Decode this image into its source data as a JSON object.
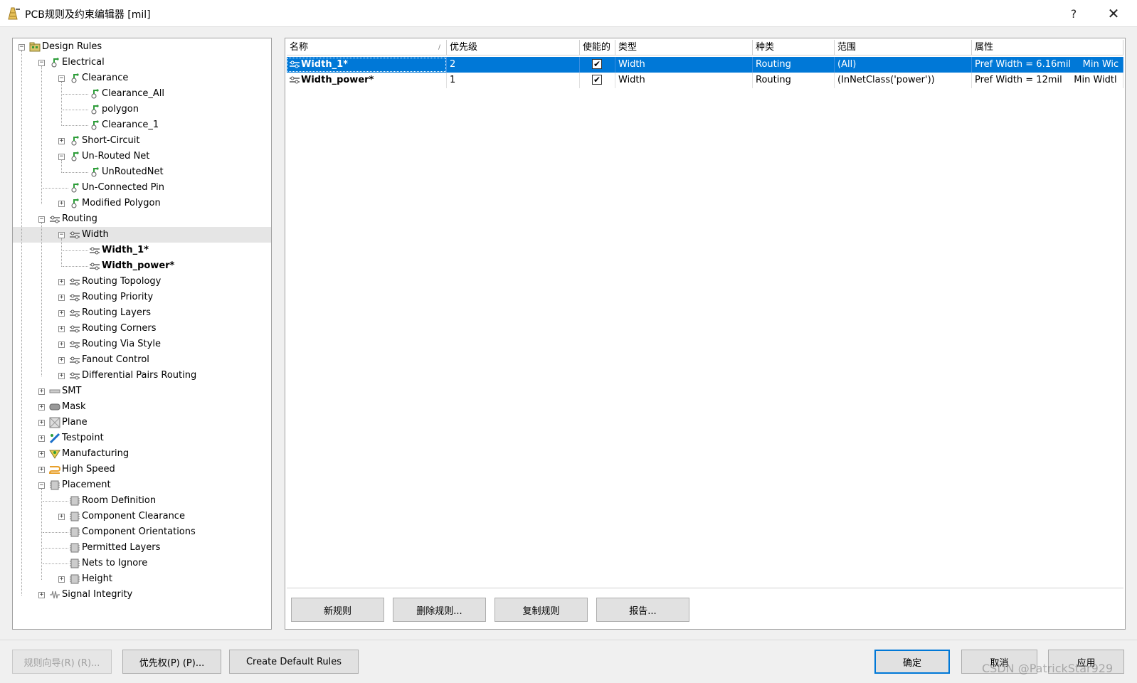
{
  "window": {
    "title": "PCB规则及约束编辑器 [mil]",
    "help_label": "?",
    "close_label": "✕"
  },
  "tree": [
    {
      "id": "design-rules",
      "label": "Design Rules",
      "level": 0,
      "expander": "minus",
      "icon": "folder-icon"
    },
    {
      "id": "electrical",
      "label": "Electrical",
      "level": 1,
      "expander": "minus",
      "icon": "electrical-rule-icon"
    },
    {
      "id": "clearance",
      "label": "Clearance",
      "level": 2,
      "expander": "minus",
      "icon": "electrical-rule-icon"
    },
    {
      "id": "clearance-all",
      "label": "Clearance_All",
      "level": 3,
      "expander": "none",
      "icon": "electrical-rule-icon"
    },
    {
      "id": "polygon",
      "label": "polygon",
      "level": 3,
      "expander": "none",
      "icon": "electrical-rule-icon"
    },
    {
      "id": "clearance-1",
      "label": "Clearance_1",
      "level": 3,
      "expander": "none",
      "icon": "electrical-rule-icon"
    },
    {
      "id": "short-circuit",
      "label": "Short-Circuit",
      "level": 2,
      "expander": "plus",
      "icon": "electrical-rule-icon"
    },
    {
      "id": "un-routed-net",
      "label": "Un-Routed Net",
      "level": 2,
      "expander": "minus",
      "icon": "electrical-rule-icon"
    },
    {
      "id": "unroutednet",
      "label": "UnRoutedNet",
      "level": 3,
      "expander": "none",
      "icon": "electrical-rule-icon"
    },
    {
      "id": "un-connected-pin",
      "label": "Un-Connected Pin",
      "level": 2,
      "expander": "none",
      "icon": "electrical-rule-icon"
    },
    {
      "id": "modified-polygon",
      "label": "Modified Polygon",
      "level": 2,
      "expander": "plus",
      "icon": "electrical-rule-icon"
    },
    {
      "id": "routing",
      "label": "Routing",
      "level": 1,
      "expander": "minus",
      "icon": "routing-rule-icon"
    },
    {
      "id": "width",
      "label": "Width",
      "level": 2,
      "expander": "minus",
      "icon": "routing-rule-icon",
      "highlight": true
    },
    {
      "id": "width-1",
      "label": "Width_1*",
      "level": 3,
      "expander": "none",
      "icon": "routing-rule-icon",
      "bold": true
    },
    {
      "id": "width-power",
      "label": "Width_power*",
      "level": 3,
      "expander": "none",
      "icon": "routing-rule-icon",
      "bold": true
    },
    {
      "id": "routing-topology",
      "label": "Routing Topology",
      "level": 2,
      "expander": "plus",
      "icon": "routing-rule-icon"
    },
    {
      "id": "routing-priority",
      "label": "Routing Priority",
      "level": 2,
      "expander": "plus",
      "icon": "routing-rule-icon"
    },
    {
      "id": "routing-layers",
      "label": "Routing Layers",
      "level": 2,
      "expander": "plus",
      "icon": "routing-rule-icon"
    },
    {
      "id": "routing-corners",
      "label": "Routing Corners",
      "level": 2,
      "expander": "plus",
      "icon": "routing-rule-icon"
    },
    {
      "id": "routing-via-style",
      "label": "Routing Via Style",
      "level": 2,
      "expander": "plus",
      "icon": "routing-rule-icon"
    },
    {
      "id": "fanout-control",
      "label": "Fanout Control",
      "level": 2,
      "expander": "plus",
      "icon": "routing-rule-icon"
    },
    {
      "id": "differential-pairs-routing",
      "label": "Differential Pairs Routing",
      "level": 2,
      "expander": "plus",
      "icon": "routing-rule-icon"
    },
    {
      "id": "smt",
      "label": "SMT",
      "level": 1,
      "expander": "plus",
      "icon": "smt-rule-icon"
    },
    {
      "id": "mask",
      "label": "Mask",
      "level": 1,
      "expander": "plus",
      "icon": "mask-rule-icon"
    },
    {
      "id": "plane",
      "label": "Plane",
      "level": 1,
      "expander": "plus",
      "icon": "plane-rule-icon"
    },
    {
      "id": "testpoint",
      "label": "Testpoint",
      "level": 1,
      "expander": "plus",
      "icon": "testpoint-rule-icon"
    },
    {
      "id": "manufacturing",
      "label": "Manufacturing",
      "level": 1,
      "expander": "plus",
      "icon": "manufacturing-rule-icon"
    },
    {
      "id": "high-speed",
      "label": "High Speed",
      "level": 1,
      "expander": "plus",
      "icon": "high-speed-rule-icon"
    },
    {
      "id": "placement",
      "label": "Placement",
      "level": 1,
      "expander": "minus",
      "icon": "placement-rule-icon"
    },
    {
      "id": "room-definition",
      "label": "Room Definition",
      "level": 2,
      "expander": "none",
      "icon": "placement-rule-icon"
    },
    {
      "id": "component-clearance",
      "label": "Component Clearance",
      "level": 2,
      "expander": "plus",
      "icon": "placement-rule-icon"
    },
    {
      "id": "component-orientations",
      "label": "Component Orientations",
      "level": 2,
      "expander": "none",
      "icon": "placement-rule-icon"
    },
    {
      "id": "permitted-layers",
      "label": "Permitted Layers",
      "level": 2,
      "expander": "none",
      "icon": "placement-rule-icon"
    },
    {
      "id": "nets-to-ignore",
      "label": "Nets to Ignore",
      "level": 2,
      "expander": "none",
      "icon": "placement-rule-icon"
    },
    {
      "id": "height",
      "label": "Height",
      "level": 2,
      "expander": "plus",
      "icon": "placement-rule-icon"
    },
    {
      "id": "signal-integrity",
      "label": "Signal Integrity",
      "level": 1,
      "expander": "plus",
      "icon": "signal-integrity-rule-icon"
    }
  ],
  "table": {
    "columns": [
      "名称",
      "优先级",
      "使能的",
      "类型",
      "种类",
      "范围",
      "属性"
    ],
    "rows": [
      {
        "name": "Width_1*",
        "priority": "2",
        "enabled": true,
        "type": "Width",
        "category": "Routing",
        "scope": "(All)",
        "attrs": "Pref Width = 6.16mil    Min Wic",
        "selected": true
      },
      {
        "name": "Width_power*",
        "priority": "1",
        "enabled": true,
        "type": "Width",
        "category": "Routing",
        "scope": "(InNetClass('power'))",
        "attrs": "Pref Width = 12mil    Min Widtl",
        "selected": false
      }
    ]
  },
  "rule_buttons": {
    "new_rule": "新规则",
    "delete_rule": "删除规则...",
    "copy_rule": "复制规则",
    "report": "报告..."
  },
  "footer_buttons": {
    "rule_wizard": "规则向导(R) (R)...",
    "priorities": "优先权(P) (P)...",
    "create_default_rules": "Create Default Rules",
    "ok": "确定",
    "cancel": "取消",
    "apply": "应用"
  },
  "watermark": "CSDN @PatrickStar929",
  "colors": {
    "selection": "#0078d7",
    "default_button_border": "#0078d7",
    "rule_icon_green": "#2e9d3a"
  }
}
